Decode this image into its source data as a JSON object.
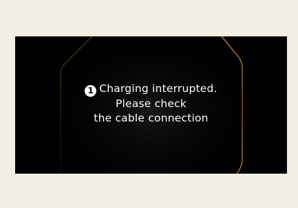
{
  "notification": {
    "icon": "info-number-1-icon",
    "icon_glyph": "1",
    "line1": "Charging interrupted.",
    "line2": "Please check",
    "line3": "the cable connection"
  },
  "colors": {
    "background": "#f4efe4",
    "screen": "#000000",
    "text": "#ffffff",
    "accent_outline": "#e0a04a"
  }
}
